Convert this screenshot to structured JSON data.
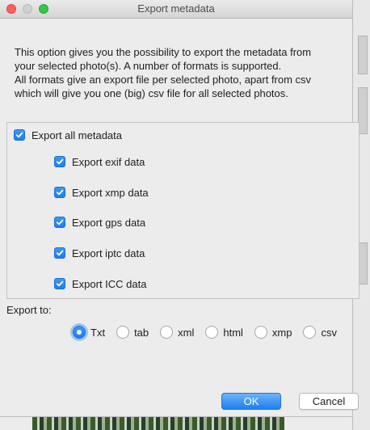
{
  "window": {
    "title": "Export metadata"
  },
  "description": [
    "This option gives you the possibility to export the metadata from",
    "your selected photo(s). A number of formats is supported.",
    "All formats give an export file per selected photo, apart from csv",
    "which will give you one (big) csv file for all selected photos."
  ],
  "metadata": {
    "all": {
      "label": "Export all metadata",
      "checked": true
    },
    "items": [
      {
        "label": "Export exif data",
        "checked": true
      },
      {
        "label": "Export xmp data",
        "checked": true
      },
      {
        "label": "Export gps data",
        "checked": true
      },
      {
        "label": "Export iptc data",
        "checked": true
      },
      {
        "label": "Export ICC data",
        "checked": true
      }
    ]
  },
  "export_to": {
    "label": "Export to:",
    "options": [
      "Txt",
      "tab",
      "xml",
      "html",
      "xmp",
      "csv"
    ],
    "selected": "Txt"
  },
  "buttons": {
    "ok": "OK",
    "cancel": "Cancel"
  },
  "colors": {
    "accent": "#1f7ef0",
    "close": "#fc615d",
    "maximize": "#34c84a"
  }
}
